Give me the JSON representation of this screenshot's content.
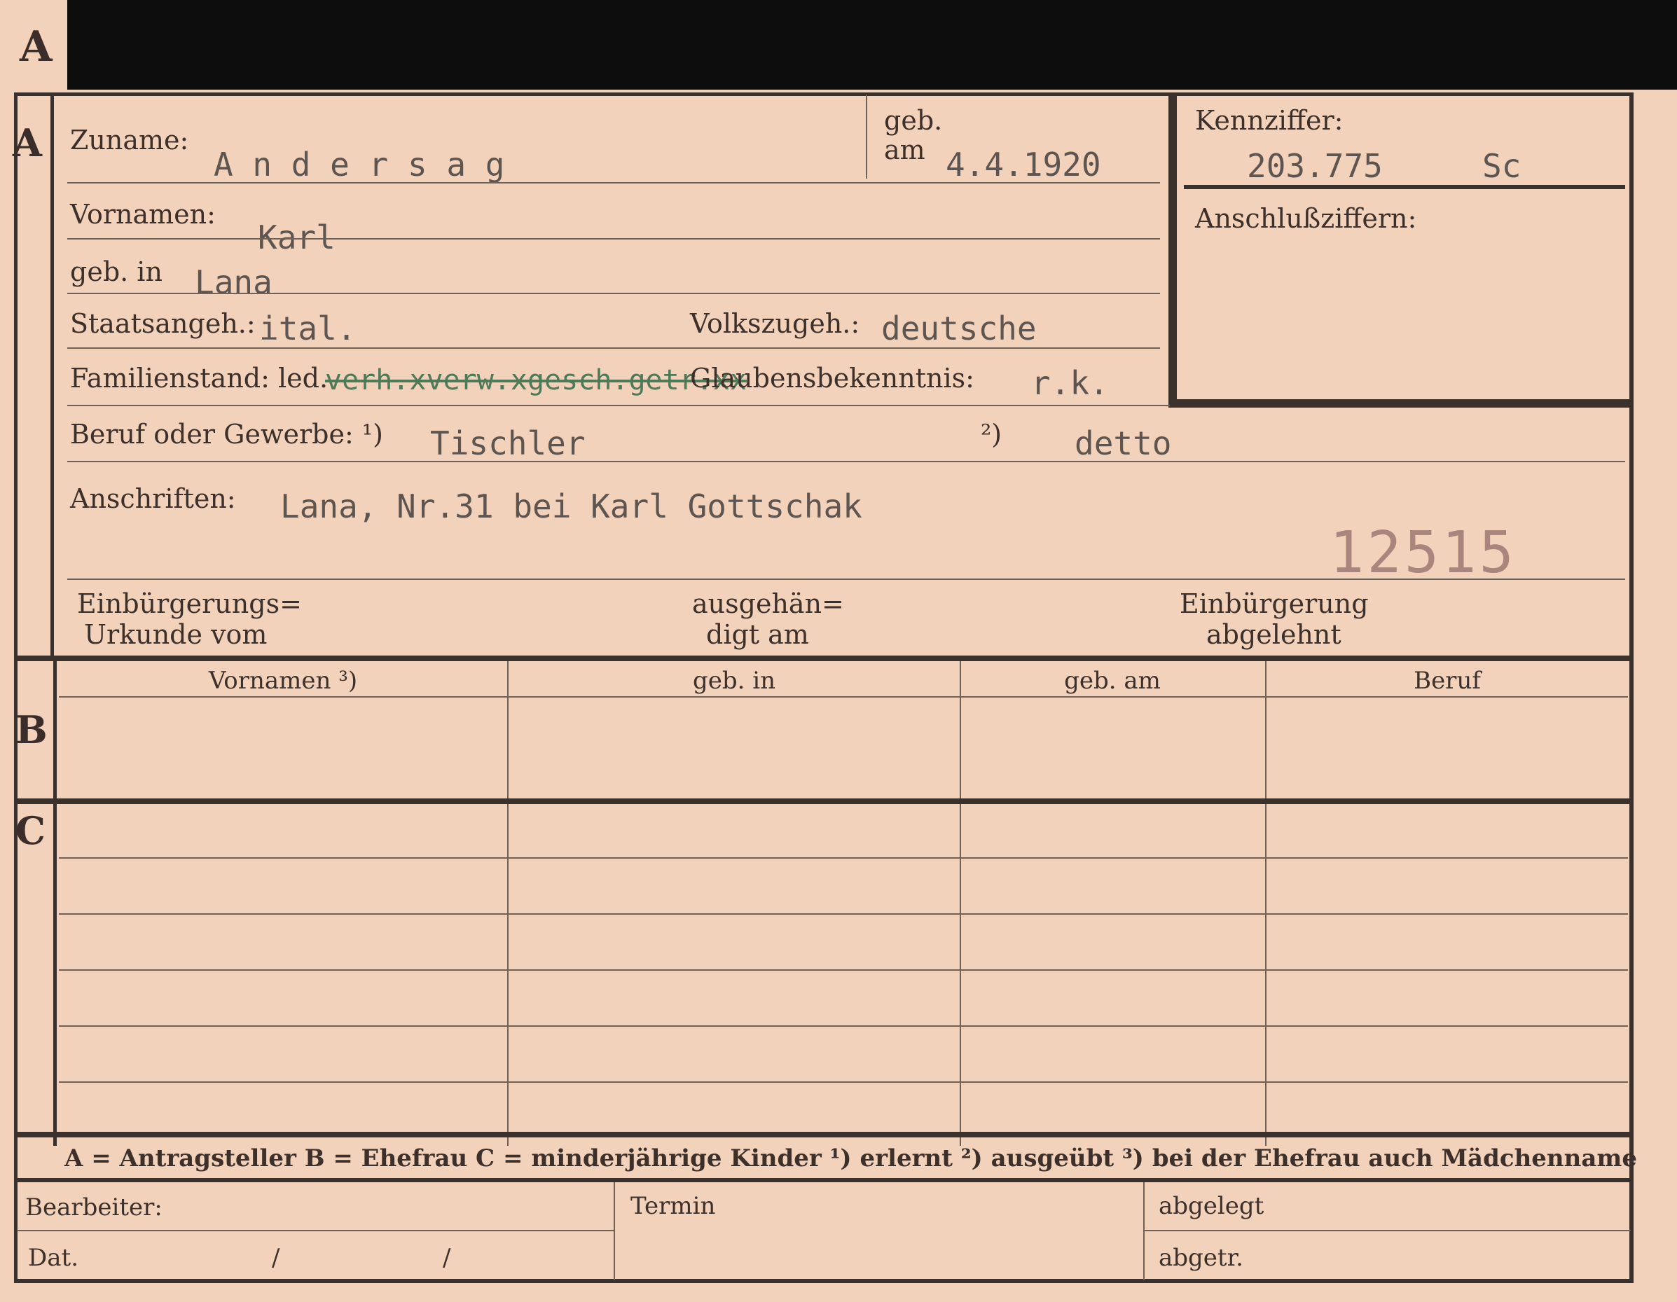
{
  "tab_letter": "A",
  "sections": {
    "a": "A",
    "b": "B",
    "c": "C"
  },
  "labels": {
    "zuname": "Zuname:",
    "geb_top": "geb.",
    "geb_am": "am",
    "kennziffer": "Kennziffer:",
    "anschlussziffern": "Anschlußziffern:",
    "vornamen": "Vornamen:",
    "geb_in": "geb. in",
    "staatsangeh": "Staatsangeh.:",
    "volkszugeh": "Volkszugeh.:",
    "familienstand": "Familienstand: led.",
    "glaubensbekenntnis": "Glaubensbekenntnis:",
    "beruf": "Beruf oder Gewerbe: ¹)",
    "beruf_2": "²)",
    "anschriften": "Anschriften:",
    "einbuergerung_1": "Einbürgerungs=",
    "einbuergerung_2": "Urkunde vom",
    "ausgehaendigt_1": "ausgehän=",
    "ausgehaendigt_2": "digt am",
    "abgelehnt_1": "Einbürgerung",
    "abgelehnt_2": "abgelehnt"
  },
  "values": {
    "zuname": "A n d e r s a g",
    "geb_am": "4.4.1920",
    "kennziffer": "203.775",
    "kennziffer_suffix": "Sc",
    "vornamen": "Karl",
    "geb_in": "Lana",
    "staatsangeh": "ital.",
    "volkszugeh": "deutsche",
    "familienstand_struck": "verh.xverw.xgesch.getr.xx",
    "glaubensbekenntnis": "r.k.",
    "beruf_erlernt": "Tischler",
    "beruf_ausgeuebt": "detto",
    "anschriften": "Lana, Nr.31 bei Karl Gottschak",
    "stamp_number": "12515"
  },
  "table": {
    "headers": [
      "Vornamen ³)",
      "geb. in",
      "geb. am",
      "Beruf"
    ]
  },
  "footer": {
    "legend": "A = Antragsteller   B = Ehefrau   C = minderjährige Kinder   ¹) erlernt   ²) ausgeübt   ³) bei der Ehefrau auch Mädchenname",
    "bearbeiter": "Bearbeiter:",
    "termin": "Termin",
    "abgelegt": "abgelegt",
    "dat": "Dat.",
    "slash1": "/",
    "slash2": "/",
    "abgetr": "abgetr."
  }
}
